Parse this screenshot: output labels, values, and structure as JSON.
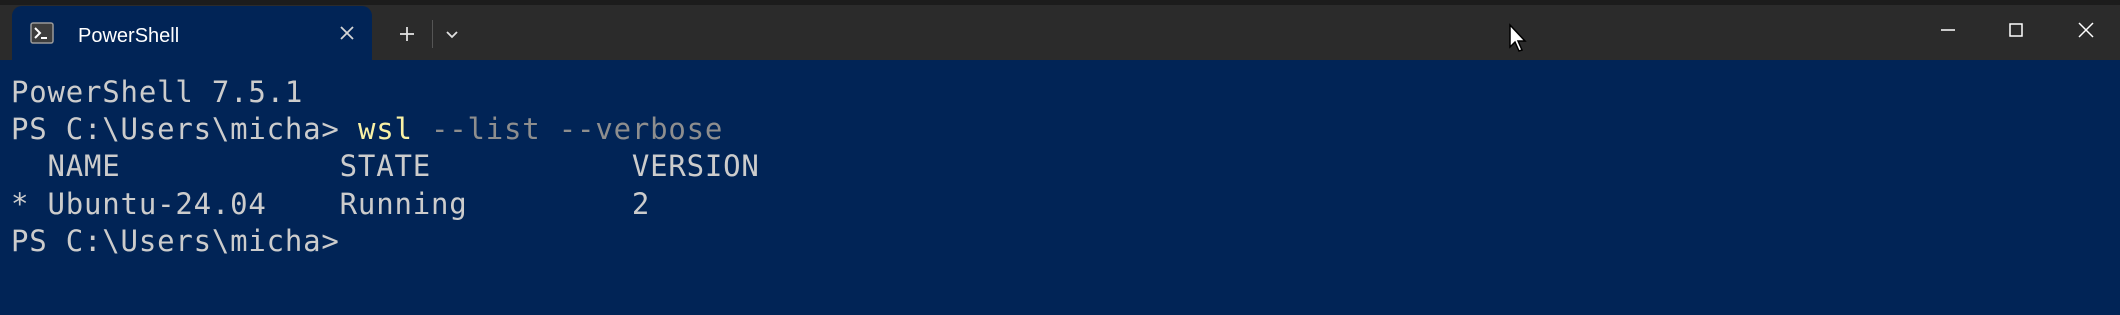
{
  "tab": {
    "title": "PowerShell"
  },
  "icons": {
    "tab_icon": "powershell-icon",
    "close": "close-icon",
    "new_tab": "plus-icon",
    "dropdown": "chevron-down-icon",
    "minimize": "minimize-icon",
    "maximize": "maximize-icon",
    "window_close": "close-icon",
    "cursor": "mouse-cursor-icon"
  },
  "colors": {
    "terminal_bg": "#012456",
    "titlebar_bg": "#2b2b2b",
    "text": "#cccccc",
    "command": "#f9f1a5",
    "argument": "#8e8e8e"
  },
  "terminal": {
    "banner": "PowerShell 7.5.1",
    "prompt1": "PS C:\\Users\\micha> ",
    "command": "wsl",
    "args": " --list --verbose",
    "header": "  NAME            STATE           VERSION",
    "row1": "* Ubuntu-24.04    Running         2",
    "prompt2": "PS C:\\Users\\micha>"
  }
}
